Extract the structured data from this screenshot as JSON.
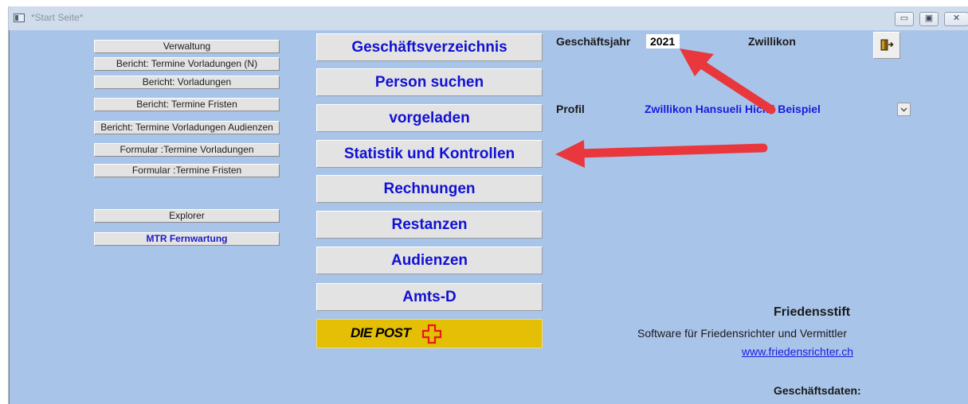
{
  "window": {
    "title": "*Start Seite*",
    "controls": {
      "minimize": "▭",
      "maximize": "▣",
      "close": "✕"
    }
  },
  "left_menu": [
    "Verwaltung",
    "Bericht: Termine Vorladungen (N)",
    "Bericht: Vorladungen",
    "Bericht: Termine Fristen",
    "Bericht: Termine Vorladungen Audienzen",
    "Formular :Termine Vorladungen",
    "Formular :Termine Fristen"
  ],
  "tools_menu": {
    "explorer": "Explorer",
    "remote": "MTR Fernwartung"
  },
  "main_buttons": [
    "Geschäftsverzeichnis",
    "Person suchen",
    "vorgeladen",
    "Statistik und Kontrollen",
    "Rechnungen",
    "Restanzen",
    "Audienzen",
    "Amts-D"
  ],
  "post_button": {
    "label": "DIE POST"
  },
  "header": {
    "year_label": "Geschäftsjahr",
    "year_value": "2021",
    "location": "Zwillikon"
  },
  "profile": {
    "label": "Profil",
    "value": "Zwillikon Hansueli Hickli Beispiel"
  },
  "info": {
    "title": "Friedensstift",
    "subtitle": "Software für Friedensrichter und Vermittler",
    "website": "www.friedensrichter.ch",
    "business_data_label": "Geschäftsdaten:"
  },
  "colors": {
    "background": "#a9c4e9",
    "button_text": "#1111d4",
    "post_yellow": "#e4bf06",
    "annotation_arrow": "#e8383d"
  },
  "icons": {
    "exit": "exit-door-icon",
    "dropdown": "chevron-down-icon",
    "post_logo": "swiss-cross-icon"
  }
}
